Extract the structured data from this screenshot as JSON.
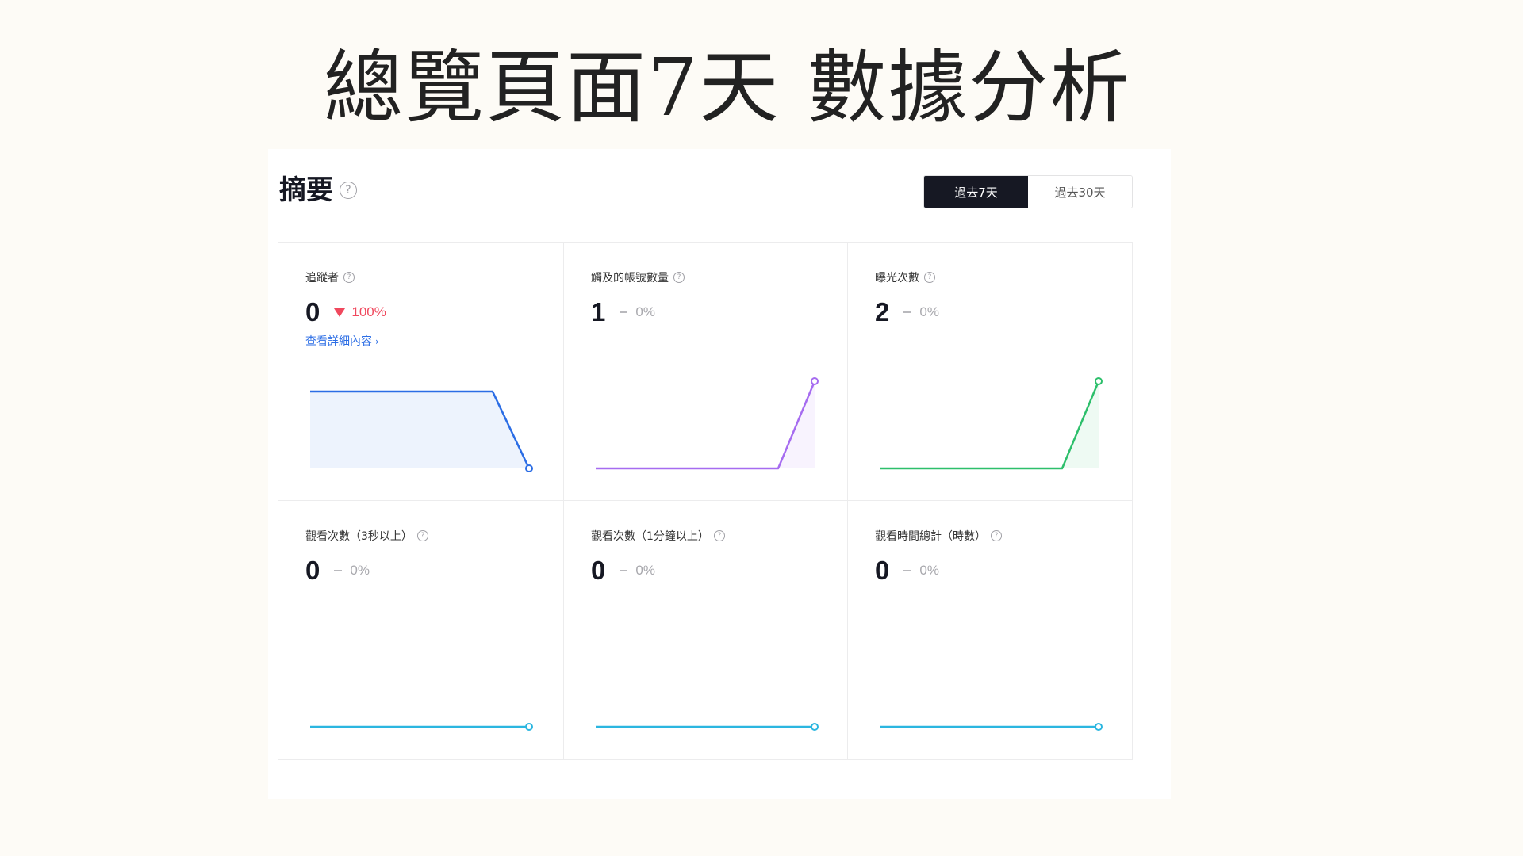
{
  "slide_title": "總覽頁面7天 數據分析",
  "summary": {
    "title": "摘要",
    "help_glyph": "?"
  },
  "range_toggle": {
    "options": [
      "過去7天",
      "過去30天"
    ],
    "selected": "過去7天"
  },
  "cards": [
    {
      "label": "追蹤者",
      "value": "0",
      "trend": "down",
      "change": "100%",
      "link": "查看詳細內容",
      "link_chevron": "›",
      "sparkline": {
        "color": "#2b6de5",
        "fill": "#edf3fd",
        "values": [
          1,
          1,
          1,
          1,
          1,
          1,
          0
        ],
        "marker": "end"
      }
    },
    {
      "label": "觸及的帳號數量",
      "value": "1",
      "trend": "flat",
      "change": "0%",
      "sparkline": {
        "color": "#a66cf0",
        "fill": "#f8f3fe",
        "values": [
          0,
          0,
          0,
          0,
          0,
          0,
          1
        ],
        "marker": "end"
      }
    },
    {
      "label": "曝光次數",
      "value": "2",
      "trend": "flat",
      "change": "0%",
      "sparkline": {
        "color": "#2dbf6b",
        "fill": "#eefaf3",
        "values": [
          0,
          0,
          0,
          0,
          0,
          0,
          2
        ],
        "marker": "end"
      }
    },
    {
      "label": "觀看次數（3秒以上）",
      "value": "0",
      "trend": "flat",
      "change": "0%",
      "sparkline": {
        "color": "#2bb6e0",
        "fill": "none",
        "values": [
          0,
          0,
          0,
          0,
          0,
          0,
          0
        ],
        "marker": "end"
      }
    },
    {
      "label": "觀看次數（1分鐘以上）",
      "value": "0",
      "trend": "flat",
      "change": "0%",
      "sparkline": {
        "color": "#2bb6e0",
        "fill": "none",
        "values": [
          0,
          0,
          0,
          0,
          0,
          0,
          0
        ],
        "marker": "end"
      }
    },
    {
      "label": "觀看時間總計（時數）",
      "value": "0",
      "trend": "flat",
      "change": "0%",
      "sparkline": {
        "color": "#2bb6e0",
        "fill": "none",
        "values": [
          0,
          0,
          0,
          0,
          0,
          0,
          0
        ],
        "marker": "end"
      }
    }
  ]
}
